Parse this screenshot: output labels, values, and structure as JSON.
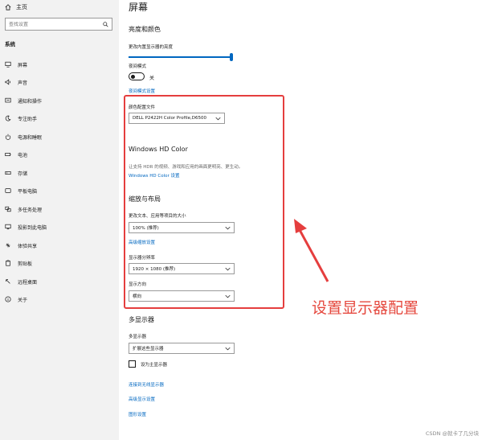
{
  "sidebar": {
    "home_label": "主页",
    "search_placeholder": "查找设置",
    "section_title": "系统",
    "items": [
      {
        "label": "屏幕",
        "icon": "monitor-icon"
      },
      {
        "label": "声音",
        "icon": "speaker-icon"
      },
      {
        "label": "通知和操作",
        "icon": "notification-icon"
      },
      {
        "label": "专注助手",
        "icon": "moon-icon"
      },
      {
        "label": "电源和睡眠",
        "icon": "power-icon"
      },
      {
        "label": "电池",
        "icon": "battery-icon"
      },
      {
        "label": "存储",
        "icon": "storage-icon"
      },
      {
        "label": "平板电脑",
        "icon": "tablet-icon"
      },
      {
        "label": "多任务处理",
        "icon": "multitask-icon"
      },
      {
        "label": "投影到此电脑",
        "icon": "project-icon"
      },
      {
        "label": "体验共享",
        "icon": "share-icon"
      },
      {
        "label": "剪贴板",
        "icon": "clipboard-icon"
      },
      {
        "label": "远程桌面",
        "icon": "remote-desktop-icon"
      },
      {
        "label": "关于",
        "icon": "info-icon"
      }
    ]
  },
  "main": {
    "title": "屏幕",
    "brightness": {
      "heading": "亮度和颜色",
      "slider_label": "更改内置显示器的亮度",
      "level": 1.0
    },
    "night_light": {
      "label": "夜间模式",
      "state_label": "关",
      "settings_link": "夜间模式设置"
    },
    "color_profile": {
      "label": "颜色配置文件",
      "value": "DELL P2422H  Color Profile,D6500"
    },
    "hd_color": {
      "heading": "Windows HD Color",
      "description": "让支持 HDR 的视频、游戏和应用的画面更明亮、更生动。",
      "link": "Windows HD Color 设置"
    },
    "scale_layout": {
      "heading": "缩放与布局",
      "scale_label": "更改文本、应用等项目的大小",
      "scale_value": "100% (推荐)",
      "advanced_link": "高级缩放设置",
      "resolution_label": "显示器分辨率",
      "resolution_value": "1920 × 1080 (推荐)",
      "orientation_label": "显示方向",
      "orientation_value": "横向"
    },
    "multi_display": {
      "heading": "多显示器",
      "label": "多显示器",
      "value": "扩展这些显示器",
      "primary_checkbox": "设为主显示器",
      "link_wireless": "连接到无线显示器",
      "link_advanced": "高级显示设置",
      "link_graphics": "图形设置"
    }
  },
  "annotation": {
    "text": "设置显示器配置",
    "color": "#e53e3e"
  },
  "watermark": "CSDN @就卡了几分块",
  "colors": {
    "accent": "#0067c0",
    "sidebar_bg": "#f2f2f2"
  }
}
